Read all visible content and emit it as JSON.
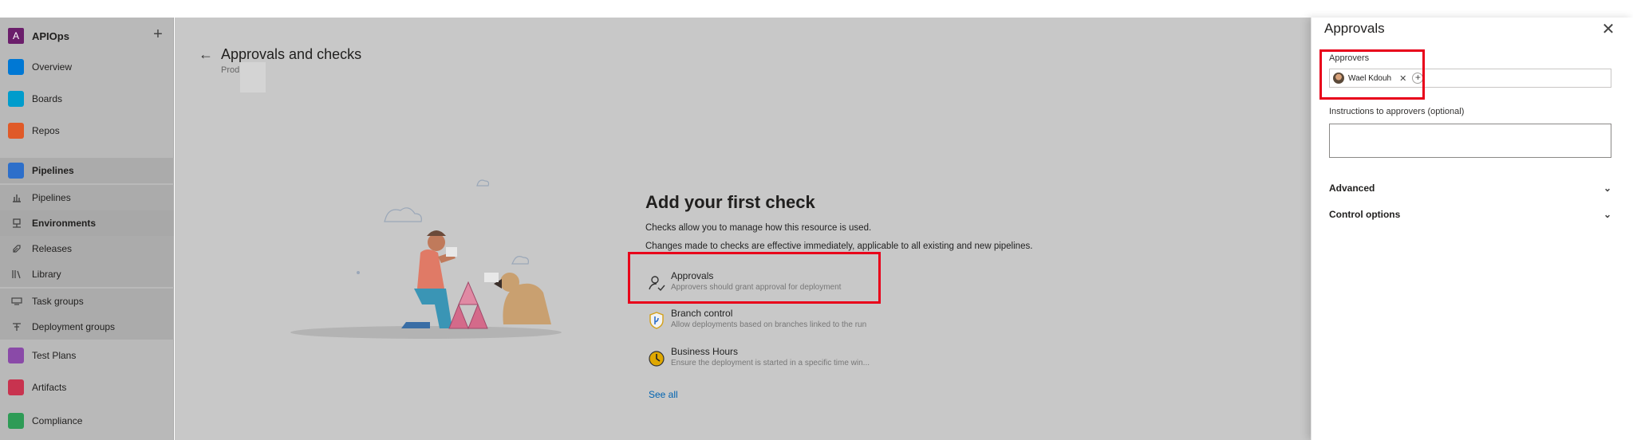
{
  "nav": {
    "org_initial": "A",
    "org_name": "APIOps",
    "add_label": "+",
    "items": [
      {
        "label": "Overview",
        "icon": "overview-icon",
        "color": "#0078d4"
      },
      {
        "label": "Boards",
        "icon": "boards-icon",
        "color": "#009ccc"
      },
      {
        "label": "Repos",
        "icon": "repos-icon",
        "color": "#e05a28"
      },
      {
        "label": "Pipelines",
        "icon": "pipelines-icon",
        "color": "#2d6fca"
      },
      {
        "label": "Pipelines",
        "icon": "pipelines-sub-icon"
      },
      {
        "label": "Environments",
        "icon": "environments-icon"
      },
      {
        "label": "Releases",
        "icon": "releases-icon"
      },
      {
        "label": "Library",
        "icon": "library-icon"
      },
      {
        "label": "Task groups",
        "icon": "task-groups-icon"
      },
      {
        "label": "Deployment groups",
        "icon": "deployment-groups-icon"
      },
      {
        "label": "Test Plans",
        "icon": "test-plans-icon",
        "color": "#8a4aa8"
      },
      {
        "label": "Artifacts",
        "icon": "artifacts-icon",
        "color": "#c8334f"
      },
      {
        "label": "Compliance",
        "icon": "compliance-icon",
        "color": "#2e9b56"
      }
    ]
  },
  "main": {
    "back_icon": "←",
    "title": "Approvals and checks",
    "subtitle": "Prod",
    "empty_title": "Add your first check",
    "empty_line1": "Checks allow you to manage how this resource is used.",
    "empty_line2": "Changes made to checks are effective immediately, applicable to all existing and new pipelines.",
    "checks": [
      {
        "title": "Approvals",
        "desc": "Approvers should grant approval for deployment",
        "icon": "person-check-icon"
      },
      {
        "title": "Branch control",
        "desc": "Allow deployments based on branches linked to the run",
        "icon": "shield-branch-icon"
      },
      {
        "title": "Business Hours",
        "desc": "Ensure the deployment is started in a specific time win...",
        "icon": "clock-icon"
      }
    ],
    "see_all": "See all"
  },
  "panel": {
    "title": "Approvals",
    "close_glyph": "✕",
    "approvers_label": "Approvers",
    "approver_name": "Wael Kdouh",
    "remove_glyph": "✕",
    "add_glyph": "+",
    "instructions_label": "Instructions to approvers (optional)",
    "instructions_value": "",
    "advanced_label": "Advanced",
    "control_options_label": "Control options",
    "chevron_glyph": "⌄"
  },
  "colors": {
    "highlight": "#e8001a",
    "link": "#0063b1"
  }
}
